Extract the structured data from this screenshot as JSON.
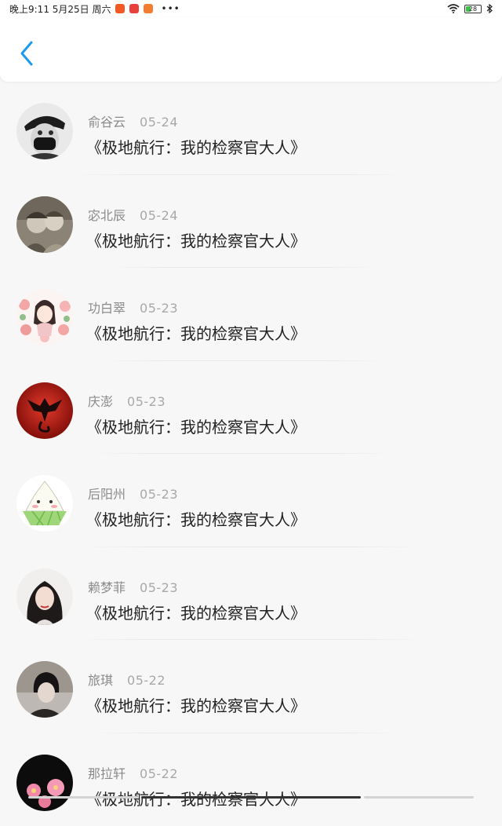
{
  "status": {
    "time": "晚上9:11 5月25日 周六",
    "more": "•••",
    "battery": "28",
    "app_colors": [
      "#f15a24",
      "#e8413c",
      "#f47c2f"
    ]
  },
  "header": {
    "back_icon": "chevron-left-icon",
    "accent_color": "#1a9bf0"
  },
  "items": [
    {
      "name": "俞谷云",
      "date": "05-24",
      "title": "《极地航行：我的检察官大人》"
    },
    {
      "name": "宓北辰",
      "date": "05-24",
      "title": "《极地航行：我的检察官大人》"
    },
    {
      "name": "功白翠",
      "date": "05-23",
      "title": "《极地航行：我的检察官大人》"
    },
    {
      "name": "庆澎",
      "date": "05-23",
      "title": "《极地航行：我的检察官大人》"
    },
    {
      "name": "后阳州",
      "date": "05-23",
      "title": "《极地航行：我的检察官大人》"
    },
    {
      "name": "赖梦菲",
      "date": "05-23",
      "title": "《极地航行：我的检察官大人》"
    },
    {
      "name": "旅琪",
      "date": "05-22",
      "title": "《极地航行：我的检察官大人》"
    },
    {
      "name": "那拉轩",
      "date": "05-22",
      "title": "《极地航行：我的检察官大人》"
    }
  ]
}
